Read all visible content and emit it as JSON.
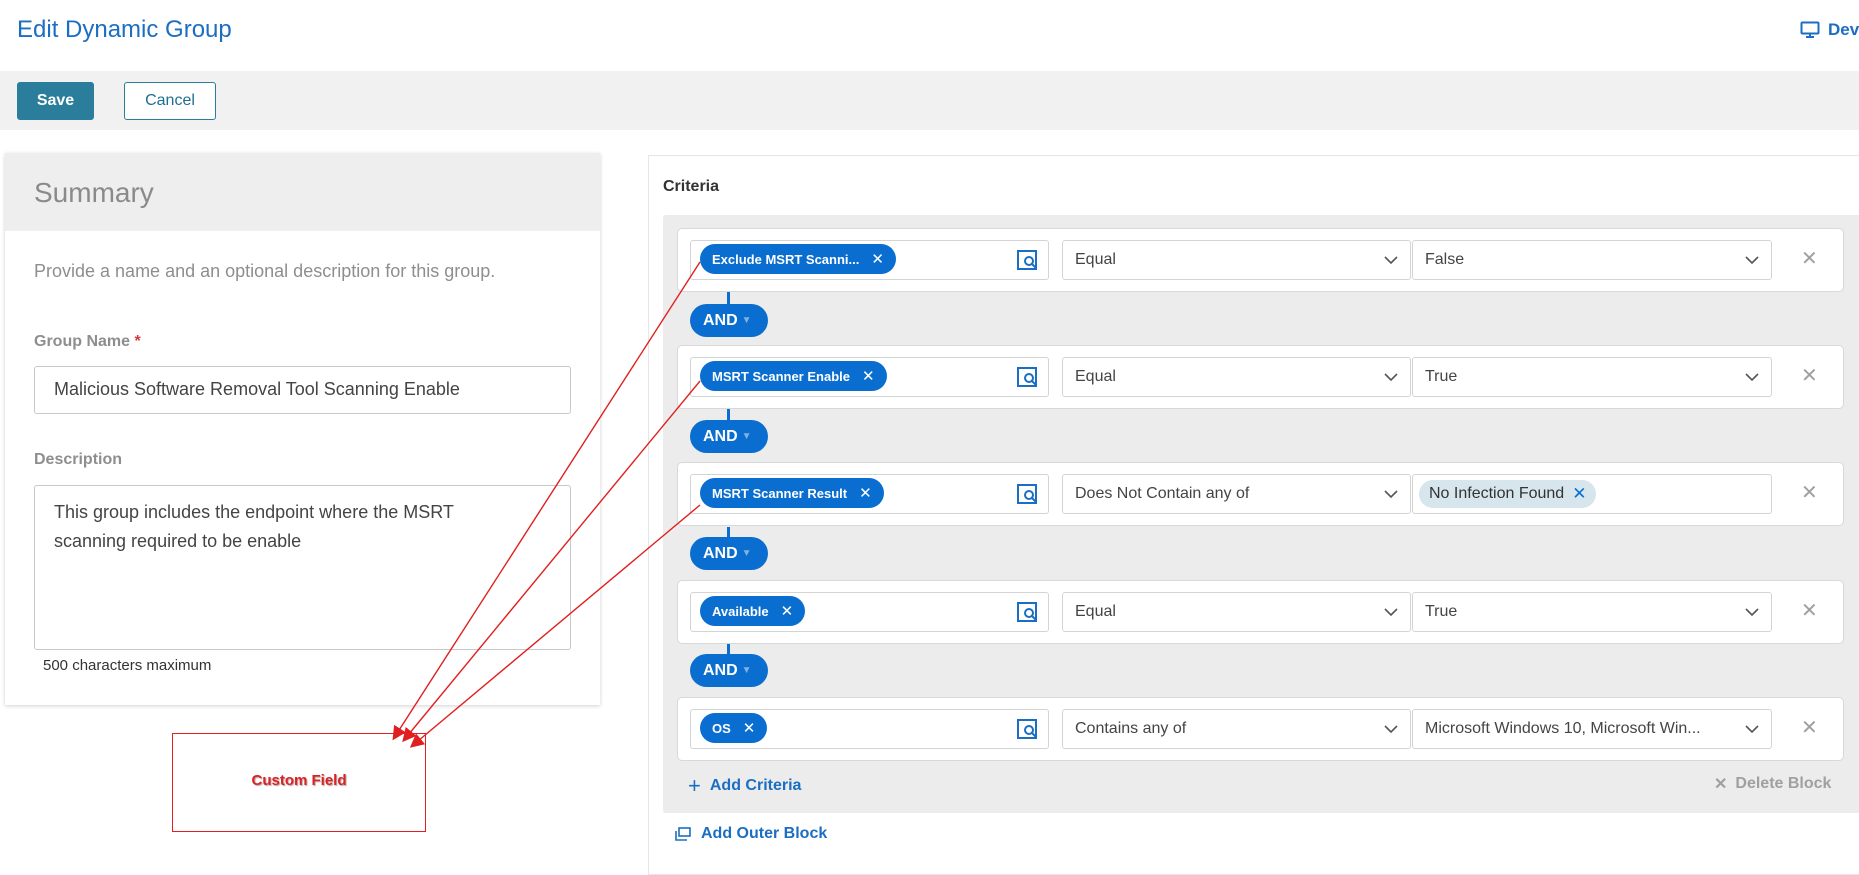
{
  "header": {
    "title": "Edit Dynamic Group",
    "dev_link_label": "Dev"
  },
  "toolbar": {
    "save_label": "Save",
    "cancel_label": "Cancel"
  },
  "summary": {
    "title": "Summary",
    "description": "Provide a name and an optional description for this group.",
    "group_name_label": "Group Name",
    "required_marker": "*",
    "group_name_value": "Malicious Software Removal Tool Scanning Enable",
    "description_label": "Description",
    "description_line1": "This group includes the endpoint where the MSRT",
    "description_line2": "scanning required to be enable",
    "char_limit_hint": "500 characters maximum"
  },
  "criteria": {
    "title": "Criteria",
    "and_label": "AND",
    "rows": [
      {
        "field": "Exclude MSRT Scanni...",
        "operator": "Equal",
        "value": "False"
      },
      {
        "field": "MSRT Scanner Enable",
        "operator": "Equal",
        "value": "True"
      },
      {
        "field": "MSRT Scanner Result",
        "operator": "Does Not Contain any of",
        "value_tag": "No Infection Found"
      },
      {
        "field": "Available",
        "operator": "Equal",
        "value": "True"
      },
      {
        "field": "OS",
        "operator": "Contains any of",
        "value": "Microsoft Windows 10, Microsoft Win..."
      }
    ],
    "add_criteria_label": "Add Criteria",
    "delete_block_label": "Delete Block",
    "add_outer_block_label": "Add Outer Block"
  },
  "annotation": {
    "label": "Custom Field"
  },
  "colors": {
    "primary_blue": "#0a6ed1",
    "save_teal": "#2a7d9b",
    "annotation_red": "#e02020"
  }
}
